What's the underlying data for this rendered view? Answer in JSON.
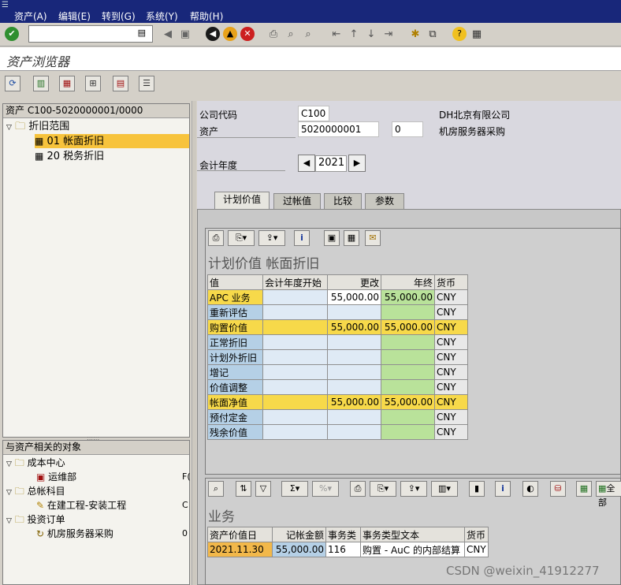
{
  "menu": {
    "items": [
      "资产(A)",
      "编辑(E)",
      "转到(G)",
      "系统(Y)",
      "帮助(H)"
    ]
  },
  "window": {
    "title": "资产浏览器"
  },
  "tree_top": {
    "header": "资产 C100-5020000001/0000",
    "root": "折旧范围",
    "items": [
      {
        "code": "01",
        "label": "帐面折旧"
      },
      {
        "code": "20",
        "label": "税务折旧"
      }
    ]
  },
  "tree_bottom": {
    "header": "与资产相关的对象",
    "groups": [
      {
        "label": "成本中心",
        "child": "运维部",
        "suffix": "F("
      },
      {
        "label": "总帐科目",
        "child": "在建工程-安装工程",
        "suffix": "C"
      },
      {
        "label": "投资订单",
        "child": "机房服务器采购",
        "suffix": "0"
      }
    ]
  },
  "header_fields": {
    "company_code_label": "公司代码",
    "company_code": "C100",
    "company_name": "DH北京有限公司",
    "asset_label": "资产",
    "asset_number": "5020000001",
    "asset_sub": "0",
    "asset_desc": "机房服务器采购",
    "fiscal_year_label": "会计年度",
    "fiscal_year": "2021"
  },
  "tabs": [
    "计划价值",
    "过帐值",
    "比较",
    "参数"
  ],
  "plan_section": {
    "title": "计划价值 帐面折旧",
    "columns": [
      "值",
      "会计年度开始",
      "更改",
      "年终",
      "货币"
    ],
    "rows": [
      {
        "label": "APC 业务",
        "start": "",
        "change": "55,000.00",
        "end": "55,000.00",
        "cur": "CNY",
        "hl": false,
        "first": true
      },
      {
        "label": "重新评估",
        "start": "",
        "change": "",
        "end": "",
        "cur": "CNY",
        "hl": false
      },
      {
        "label": "购置价值",
        "start": "",
        "change": "55,000.00",
        "end": "55,000.00",
        "cur": "CNY",
        "hl": true
      },
      {
        "label": "正常折旧",
        "start": "",
        "change": "",
        "end": "",
        "cur": "CNY",
        "hl": false
      },
      {
        "label": "计划外折旧",
        "start": "",
        "change": "",
        "end": "",
        "cur": "CNY",
        "hl": false
      },
      {
        "label": "增记",
        "start": "",
        "change": "",
        "end": "",
        "cur": "CNY",
        "hl": false
      },
      {
        "label": "价值调整",
        "start": "",
        "change": "",
        "end": "",
        "cur": "CNY",
        "hl": false
      },
      {
        "label": "帐面净值",
        "start": "",
        "change": "55,000.00",
        "end": "55,000.00",
        "cur": "CNY",
        "hl": true
      },
      {
        "label": "预付定金",
        "start": "",
        "change": "",
        "end": "",
        "cur": "CNY",
        "hl": false
      },
      {
        "label": "残余价值",
        "start": "",
        "change": "",
        "end": "",
        "cur": "CNY",
        "hl": false
      }
    ]
  },
  "transactions": {
    "title": "业务",
    "columns": [
      "资产价值日",
      "记帐金额",
      "事务类",
      "事务类型文本",
      "货币"
    ],
    "rows": [
      {
        "date": "2021.11.30",
        "amount": "55,000.00",
        "type": "116",
        "text": "购置 - AuC 的内部结算",
        "cur": "CNY"
      }
    ],
    "toolbar_last_label": "全部"
  },
  "watermark": "CSDN @weixin_41912277"
}
